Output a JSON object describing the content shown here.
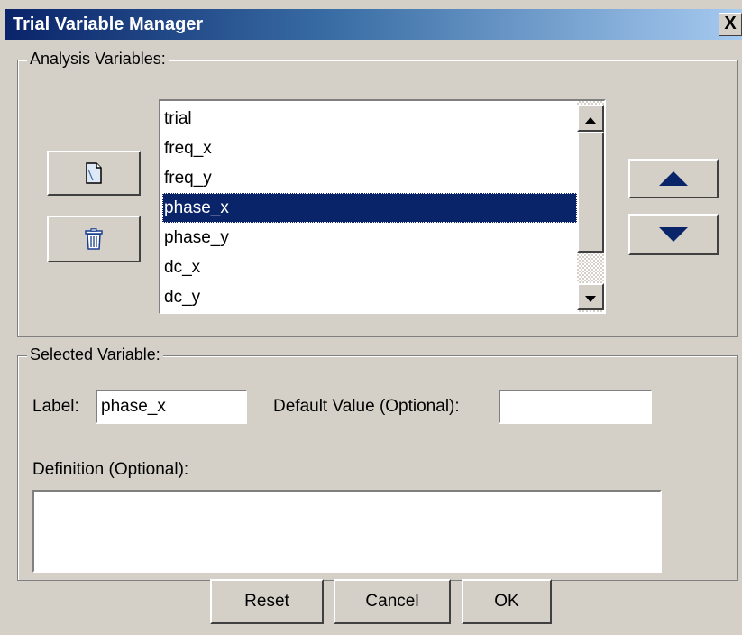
{
  "window": {
    "title": "Trial Variable Manager",
    "close_label": "X"
  },
  "analysis_group": {
    "label": "Analysis Variables:",
    "add_icon": "new-document-icon",
    "delete_icon": "trash-can-icon",
    "move_up_icon": "triangle-up-icon",
    "move_down_icon": "triangle-down-icon"
  },
  "variables": {
    "items": [
      {
        "label": "trial",
        "selected": false
      },
      {
        "label": "freq_x",
        "selected": false
      },
      {
        "label": "freq_y",
        "selected": false
      },
      {
        "label": "phase_x",
        "selected": true
      },
      {
        "label": "phase_y",
        "selected": false
      },
      {
        "label": "dc_x",
        "selected": false
      },
      {
        "label": "dc_y",
        "selected": false
      }
    ]
  },
  "selected_group": {
    "label": "Selected Variable:",
    "label_caption": "Label:",
    "label_value": "phase_x",
    "default_caption": "Default Value (Optional):",
    "default_value": "",
    "definition_caption": "Definition (Optional):",
    "definition_value": ""
  },
  "buttons": {
    "reset": "Reset",
    "cancel": "Cancel",
    "ok": "OK"
  },
  "colors": {
    "dialog_bg": "#d4d0c8",
    "selection_bg": "#0a246a",
    "title_gradient_start": "#0a246a",
    "title_gradient_end": "#a6caf0"
  }
}
